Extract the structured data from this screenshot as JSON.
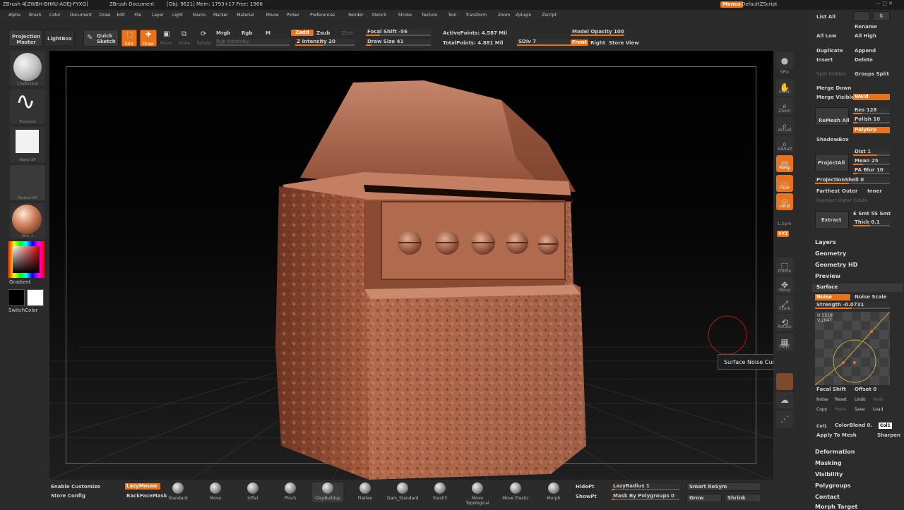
{
  "titlebar": {
    "app": "ZBrush 4[ZWBH-BHKU-ADEJ-FYXQ]",
    "doc": "ZBrush Document",
    "stats": "[Obj: 9621] Mem: 1793+17 Free: 1966",
    "menus_label": "Menus",
    "script_label": "DefaultZScript"
  },
  "menus": [
    "Alpha",
    "Brush",
    "Color",
    "Document",
    "Draw",
    "Edit",
    "File",
    "Layer",
    "Light",
    "Macro",
    "Marker",
    "Material",
    "Movie",
    "Picker",
    "Preferences",
    "Render",
    "Stencil",
    "Stroke",
    "Texture",
    "Tool",
    "Transform",
    "Zoom",
    "Zplugin",
    "Zscript"
  ],
  "toolbar": {
    "projection_master": "Projection Master",
    "lightbox": "LightBox",
    "quick_sketch": "Quick Sketch",
    "edit": "Edit",
    "draw": "Draw",
    "move": "Move",
    "scale": "Scale",
    "rotate": "Rotate",
    "mrgb": "Mrgb",
    "rgb": "Rgb",
    "m": "M",
    "rgb_intensity": "Rgb Intensity",
    "zadd": "Zadd",
    "zsub": "Zsub",
    "zcut": "Zcut",
    "z_intensity": "Z Intensity 20",
    "focal_shift": "Focal Shift -56",
    "draw_size": "Draw Size 41",
    "active_points": "ActivePoints: 4.587 Mil",
    "total_points": "TotalPoints: 4.881 Mil",
    "sdiv": "SDiv 7",
    "model_opacity": "Model Opacity 100",
    "front": "Front",
    "right": "Right",
    "store_view": "Store View"
  },
  "left": {
    "claybuildup": "ClayBuildup",
    "freehand": "Freehand",
    "alpha_off": "Alpha Off",
    "texture_off": "Texture Off",
    "material": "Skin_1",
    "gradient": "Gradient",
    "switch_color": "SwitchColor"
  },
  "rightshelf": [
    "SPix",
    "Scroll",
    "Zoom",
    "Actual",
    "AAHalf",
    "Persp",
    "Floor",
    "Local",
    "L.Sym",
    "Frame",
    "Move",
    "Scale",
    "Rotate",
    "PolyF",
    "Transp",
    "Solo",
    "Dynamic"
  ],
  "xyz_label": "XYZ",
  "tooltip": "Surface Noise Curve",
  "panel": {
    "list_all": "List All",
    "rename": "Rename",
    "all_low": "All Low",
    "all_high": "All High",
    "duplicate": "Duplicate",
    "append": "Append",
    "insert": "Insert",
    "delete": "Delete",
    "split_hidden": "Split Hidden",
    "groups_split": "Groups Split",
    "merge_down": "Merge Down",
    "merge_visible": "Merge Visible",
    "weld": "Weld",
    "remesh_all": "ReMesh All",
    "res": "Res 128",
    "polish": "Polish 10",
    "polygrp": "PolyGrp",
    "shadowbox": "ShadowBox",
    "project_all": "ProjectAll",
    "dist": "Dist 1",
    "mean": "Mean 25",
    "pa_blur": "PA Blur 10",
    "projection_shell": "ProjectionShell 0",
    "farthest": "Farthest",
    "outer": "Outer",
    "inner": "Inner",
    "reproject_higher": "Reproject Higher Subdiv",
    "extract": "Extract",
    "e_smt": "E Smt 5",
    "s_smt": "S Smt",
    "thick": "Thick 0.1",
    "layers": "Layers",
    "geometry": "Geometry",
    "geometry_hd": "Geometry HD",
    "preview": "Preview",
    "surface": "Surface",
    "noise": "Noise",
    "noise_scale": "Noise Scale",
    "strength": "Strength -0.0731",
    "curve_h": "H:5519",
    "curve_v": "V:2047",
    "focal_shift": "Focal Shift",
    "offset": "Offset 0",
    "noise2": "Noise",
    "reset": "Reset",
    "undo": "Undo",
    "redo": "Redo",
    "copy": "Copy",
    "paste": "Paste",
    "save": "Save",
    "load": "Load",
    "col": "Col1",
    "color_blend": "ColorBlend 0.",
    "col2": "Col1",
    "apply_to_mesh": "Apply To Mesh",
    "sharpen": "Sharpen",
    "deformation": "Deformation",
    "masking": "Masking",
    "visibility": "Visibility",
    "polygroups": "Polygroups",
    "contact": "Contact",
    "morph_target": "Morph Target"
  },
  "bottom": {
    "enable_customize": "Enable Customize",
    "store_config": "Store Config",
    "lazymouse": "LazyMouse",
    "backfacemask": "BackFaceMask",
    "brushes": [
      "Standard",
      "Move",
      "Inflat",
      "Pinch",
      "ClayBuildup",
      "Flatten",
      "Dam_Standard",
      "Slash3",
      "Move Topological",
      "Move Elastic",
      "Morph"
    ],
    "hidept": "HidePt",
    "showpt": "ShowPt",
    "lazy_radius": "LazyRadius 1",
    "mask_by_polygroups": "Mask By Polygroups 0",
    "smart_resym": "Smart ReSym",
    "grow": "Grow",
    "shrink": "Shrink"
  },
  "colors": {
    "accent": "#e8731c",
    "clay": "#a8644a",
    "bg": "#2b2b2b"
  }
}
